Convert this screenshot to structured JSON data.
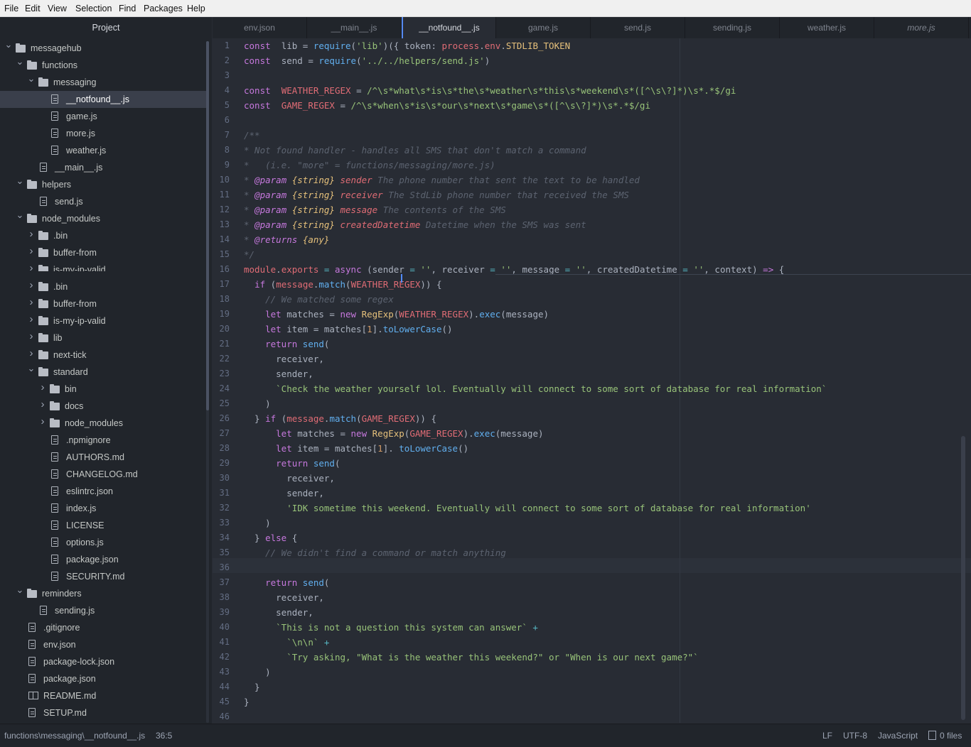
{
  "menu": [
    "File",
    "Edit",
    "View",
    "Selection",
    "Find",
    "Packages",
    "Help"
  ],
  "tree": {
    "header": "Project",
    "rows": [
      {
        "label": "messagehub",
        "kind": "folder",
        "chev": "down"
      },
      {
        "label": "functions",
        "kind": "folder",
        "chev": "down"
      },
      {
        "label": "messaging",
        "kind": "folder",
        "chev": "down"
      },
      {
        "label": "__notfound__.js",
        "kind": "file",
        "chev": "",
        "selected": true
      },
      {
        "label": "game.js",
        "kind": "file",
        "chev": ""
      },
      {
        "label": "more.js",
        "kind": "file",
        "chev": ""
      },
      {
        "label": "weather.js",
        "kind": "file",
        "chev": ""
      },
      {
        "label": "__main__.js",
        "kind": "file",
        "chev": ""
      },
      {
        "label": "helpers",
        "kind": "folder",
        "chev": "down"
      },
      {
        "label": "send.js",
        "kind": "file",
        "chev": ""
      },
      {
        "label": "node_modules",
        "kind": "folder",
        "chev": "down"
      },
      {
        "label": ".bin",
        "kind": "folder",
        "chev": "right"
      },
      {
        "label": "buffer-from",
        "kind": "folder",
        "chev": "right"
      },
      {
        "label": "is-my-ip-valid",
        "kind": "folder",
        "chev": "right"
      },
      {
        "label": ".bin",
        "kind": "folder",
        "chev": "right"
      },
      {
        "label": "buffer-from",
        "kind": "folder",
        "chev": "right"
      },
      {
        "label": "is-my-ip-valid",
        "kind": "folder",
        "chev": "right"
      },
      {
        "label": "lib",
        "kind": "folder",
        "chev": "right"
      },
      {
        "label": "next-tick",
        "kind": "folder",
        "chev": "right"
      },
      {
        "label": "standard",
        "kind": "folder",
        "chev": "down"
      },
      {
        "label": "bin",
        "kind": "folder",
        "chev": "right"
      },
      {
        "label": "docs",
        "kind": "folder",
        "chev": "right"
      },
      {
        "label": "node_modules",
        "kind": "folder",
        "chev": "right"
      },
      {
        "label": ".npmignore",
        "kind": "file",
        "chev": ""
      },
      {
        "label": "AUTHORS.md",
        "kind": "file",
        "chev": ""
      },
      {
        "label": "CHANGELOG.md",
        "kind": "file",
        "chev": ""
      },
      {
        "label": "eslintrc.json",
        "kind": "file",
        "chev": ""
      },
      {
        "label": "index.js",
        "kind": "file",
        "chev": ""
      },
      {
        "label": "LICENSE",
        "kind": "file",
        "chev": ""
      },
      {
        "label": "options.js",
        "kind": "file",
        "chev": ""
      },
      {
        "label": "package.json",
        "kind": "file",
        "chev": ""
      },
      {
        "label": "SECURITY.md",
        "kind": "file",
        "chev": ""
      },
      {
        "label": "reminders",
        "kind": "folder",
        "chev": "down"
      },
      {
        "label": "sending.js",
        "kind": "file",
        "chev": ""
      },
      {
        "label": ".gitignore",
        "kind": "file",
        "chev": ""
      },
      {
        "label": "env.json",
        "kind": "file",
        "chev": ""
      },
      {
        "label": "package-lock.json",
        "kind": "file",
        "chev": ""
      },
      {
        "label": "package.json",
        "kind": "file",
        "chev": ""
      },
      {
        "label": "README.md",
        "kind": "book",
        "chev": ""
      },
      {
        "label": "SETUP.md",
        "kind": "file",
        "chev": ""
      }
    ]
  },
  "tabs": [
    {
      "label": "env.json",
      "active": false
    },
    {
      "label": "__main__.js",
      "active": false
    },
    {
      "label": "__notfound__.js",
      "active": true
    },
    {
      "label": "game.js",
      "active": false
    },
    {
      "label": "send.js",
      "active": false
    },
    {
      "label": "sending.js",
      "active": false
    },
    {
      "label": "weather.js",
      "active": false
    },
    {
      "label": "more.js",
      "active": false,
      "italic": true
    }
  ],
  "code": [
    [
      [
        "k",
        "const"
      ],
      [
        "",
        "  lib = "
      ],
      [
        "f",
        "require"
      ],
      [
        "",
        "("
      ],
      [
        "s",
        "'lib'"
      ],
      [
        "",
        ")({ token: "
      ],
      [
        "v",
        "process"
      ],
      [
        "",
        "."
      ],
      [
        "v",
        "env"
      ],
      [
        "",
        "."
      ],
      [
        "t",
        "STDLIB_TOKEN"
      ],
      [
        "",
        "",
        " })"
      ]
    ],
    [
      [
        "k",
        "const"
      ],
      [
        "",
        "  send = "
      ],
      [
        "f",
        "require"
      ],
      [
        "",
        "("
      ],
      [
        "s",
        "'../../helpers/send.js'"
      ],
      [
        "",
        ")"
      ]
    ],
    [],
    [
      [
        "k",
        "const"
      ],
      [
        "",
        "  "
      ],
      [
        "v",
        "WEATHER_REGEX"
      ],
      [
        "",
        " = "
      ],
      [
        "s",
        "/^\\s*what\\s*is\\s*the\\s*weather\\s*this\\s*weekend\\s*([^\\s\\?]*)\\s*.*$/gi"
      ]
    ],
    [
      [
        "k",
        "const"
      ],
      [
        "",
        "  "
      ],
      [
        "v",
        "GAME_REGEX"
      ],
      [
        "",
        " = "
      ],
      [
        "s",
        "/^\\s*when\\s*is\\s*our\\s*next\\s*game\\s*([^\\s\\?]*)\\s*.*$/gi"
      ]
    ],
    [],
    [
      [
        "c",
        "/**"
      ]
    ],
    [
      [
        "c",
        "* Not found handler - handles all SMS that don't match a command"
      ]
    ],
    [
      [
        "c",
        "*   (i.e. \"more\" = functions/messaging/more.js)"
      ]
    ],
    [
      [
        "c",
        "* "
      ],
      [
        "d",
        "@param"
      ],
      [
        "c",
        " "
      ],
      [
        "ti",
        "{string}"
      ],
      [
        "c",
        " "
      ],
      [
        "vi",
        "sender"
      ],
      [
        "c",
        " The phone number that sent the text to be handled"
      ]
    ],
    [
      [
        "c",
        "* "
      ],
      [
        "d",
        "@param"
      ],
      [
        "c",
        " "
      ],
      [
        "ti",
        "{string}"
      ],
      [
        "c",
        " "
      ],
      [
        "vi",
        "receiver"
      ],
      [
        "c",
        " The StdLib phone number that received the SMS"
      ]
    ],
    [
      [
        "c",
        "* "
      ],
      [
        "d",
        "@param"
      ],
      [
        "c",
        " "
      ],
      [
        "ti",
        "{string}"
      ],
      [
        "c",
        " "
      ],
      [
        "vi",
        "message"
      ],
      [
        "c",
        " The contents of the SMS"
      ]
    ],
    [
      [
        "c",
        "* "
      ],
      [
        "d",
        "@param"
      ],
      [
        "c",
        " "
      ],
      [
        "ti",
        "{string}"
      ],
      [
        "c",
        " "
      ],
      [
        "vi",
        "createdDatetime"
      ],
      [
        "c",
        " Datetime when the SMS was sent"
      ]
    ],
    [
      [
        "c",
        "* "
      ],
      [
        "d",
        "@returns"
      ],
      [
        "c",
        " "
      ],
      [
        "ti",
        "{any}"
      ]
    ],
    [
      [
        "c",
        "*/"
      ]
    ],
    [
      [
        "v",
        "module"
      ],
      [
        "",
        "."
      ],
      [
        "v",
        "exports"
      ],
      [
        "",
        " "
      ],
      [
        "o",
        "="
      ],
      [
        "",
        " "
      ],
      [
        "k",
        "async"
      ],
      [
        "",
        " (sender "
      ],
      [
        "o",
        "="
      ],
      [
        "",
        " "
      ],
      [
        "s",
        "''"
      ],
      [
        "",
        ", receiver "
      ],
      [
        "o",
        "="
      ],
      [
        "",
        " "
      ],
      [
        "s",
        "''"
      ],
      [
        "",
        ", message "
      ],
      [
        "o",
        "="
      ],
      [
        "",
        " "
      ],
      [
        "s",
        "''"
      ],
      [
        "",
        ", createdDatetime "
      ],
      [
        "o",
        "="
      ],
      [
        "",
        " "
      ],
      [
        "s",
        "''"
      ],
      [
        "",
        ", context) "
      ],
      [
        "k",
        "=>"
      ],
      [
        "",
        " {"
      ]
    ],
    [
      [
        "",
        "  "
      ],
      [
        "k",
        "if"
      ],
      [
        "",
        " ("
      ],
      [
        "v",
        "message"
      ],
      [
        "",
        "."
      ],
      [
        "f",
        "match"
      ],
      [
        "",
        "("
      ],
      [
        "v",
        "WEATHER_REGEX"
      ],
      [
        "",
        ")) {"
      ]
    ],
    [
      [
        "",
        "    "
      ],
      [
        "c",
        "// We matched some regex"
      ]
    ],
    [
      [
        "",
        "    "
      ],
      [
        "k",
        "let"
      ],
      [
        "",
        " matches = "
      ],
      [
        "k",
        "new"
      ],
      [
        "",
        " "
      ],
      [
        "t",
        "RegExp"
      ],
      [
        "",
        "("
      ],
      [
        "v",
        "WEATHER_REGEX"
      ],
      [
        "",
        ")."
      ],
      [
        "f",
        "exec"
      ],
      [
        "",
        "(message)"
      ]
    ],
    [
      [
        "",
        "    "
      ],
      [
        "k",
        "let"
      ],
      [
        "",
        " item = matches["
      ],
      [
        "n",
        "1"
      ],
      [
        "",
        "]."
      ],
      [
        "f",
        "toLowerCase"
      ],
      [
        "",
        "()"
      ]
    ],
    [
      [
        "",
        "    "
      ],
      [
        "k",
        "return"
      ],
      [
        "",
        " "
      ],
      [
        "f",
        "send"
      ],
      [
        "",
        "("
      ]
    ],
    [
      [
        "",
        "      receiver,"
      ]
    ],
    [
      [
        "",
        "      sender,"
      ]
    ],
    [
      [
        "",
        "      "
      ],
      [
        "s",
        "`Check the weather yourself lol. Eventually will connect to some sort of database for real information`"
      ]
    ],
    [
      [
        "",
        "    )"
      ]
    ],
    [
      [
        "",
        "  } "
      ],
      [
        "k",
        "if"
      ],
      [
        "",
        " ("
      ],
      [
        "v",
        "message"
      ],
      [
        "",
        "."
      ],
      [
        "f",
        "match"
      ],
      [
        "",
        "("
      ],
      [
        "v",
        "GAME_REGEX"
      ],
      [
        "",
        ")) {"
      ]
    ],
    [
      [
        "",
        "      "
      ],
      [
        "k",
        "let"
      ],
      [
        "",
        " matches = "
      ],
      [
        "k",
        "new"
      ],
      [
        "",
        " "
      ],
      [
        "t",
        "RegExp"
      ],
      [
        "",
        "("
      ],
      [
        "v",
        "GAME_REGEX"
      ],
      [
        "",
        ")."
      ],
      [
        "f",
        "exec"
      ],
      [
        "",
        "(message)"
      ]
    ],
    [
      [
        "",
        "      "
      ],
      [
        "k",
        "let"
      ],
      [
        "",
        " item = matches["
      ],
      [
        "n",
        "1"
      ],
      [
        "",
        "]. "
      ],
      [
        "f",
        "toLowerCase"
      ],
      [
        "",
        "()"
      ]
    ],
    [
      [
        "",
        "      "
      ],
      [
        "k",
        "return"
      ],
      [
        "",
        " "
      ],
      [
        "f",
        "send"
      ],
      [
        "",
        "("
      ]
    ],
    [
      [
        "",
        "        receiver,"
      ]
    ],
    [
      [
        "",
        "        sender,"
      ]
    ],
    [
      [
        "",
        "        "
      ],
      [
        "s",
        "'IDK sometime this weekend. Eventually will connect to some sort of database for real information'"
      ]
    ],
    [
      [
        "",
        "    )"
      ]
    ],
    [
      [
        "",
        "  } "
      ],
      [
        "k",
        "else"
      ],
      [
        "",
        " {"
      ]
    ],
    [
      [
        "",
        "    "
      ],
      [
        "c",
        "// We didn't find a command or match anything"
      ]
    ],
    [],
    [
      [
        "",
        "    "
      ],
      [
        "k",
        "return"
      ],
      [
        "",
        " "
      ],
      [
        "f",
        "send"
      ],
      [
        "",
        "("
      ]
    ],
    [
      [
        "",
        "      receiver,"
      ]
    ],
    [
      [
        "",
        "      sender,"
      ]
    ],
    [
      [
        "",
        "      "
      ],
      [
        "s",
        "`This is not a question this system can answer`"
      ],
      [
        "",
        " "
      ],
      [
        "o",
        "+"
      ]
    ],
    [
      [
        "",
        "        "
      ],
      [
        "s",
        "`\\n\\n`"
      ],
      [
        "",
        " "
      ],
      [
        "o",
        "+"
      ]
    ],
    [
      [
        "",
        "        "
      ],
      [
        "s",
        "`Try asking, \"What is the weather this weekend?\" or \"When is our next game?\"`"
      ]
    ],
    [
      [
        "",
        "    )"
      ]
    ],
    [
      [
        "",
        "  }"
      ]
    ],
    [
      [
        "",
        "}"
      ]
    ],
    []
  ],
  "status": {
    "path": "functions\\messaging\\__notfound__.js",
    "cursor": "36:5",
    "line_ending": "LF",
    "encoding": "UTF-8",
    "grammar": "JavaScript",
    "files": "0 files"
  },
  "colors": {
    "accent": "#568af2",
    "background": "#282c34",
    "panel": "#21252b"
  }
}
